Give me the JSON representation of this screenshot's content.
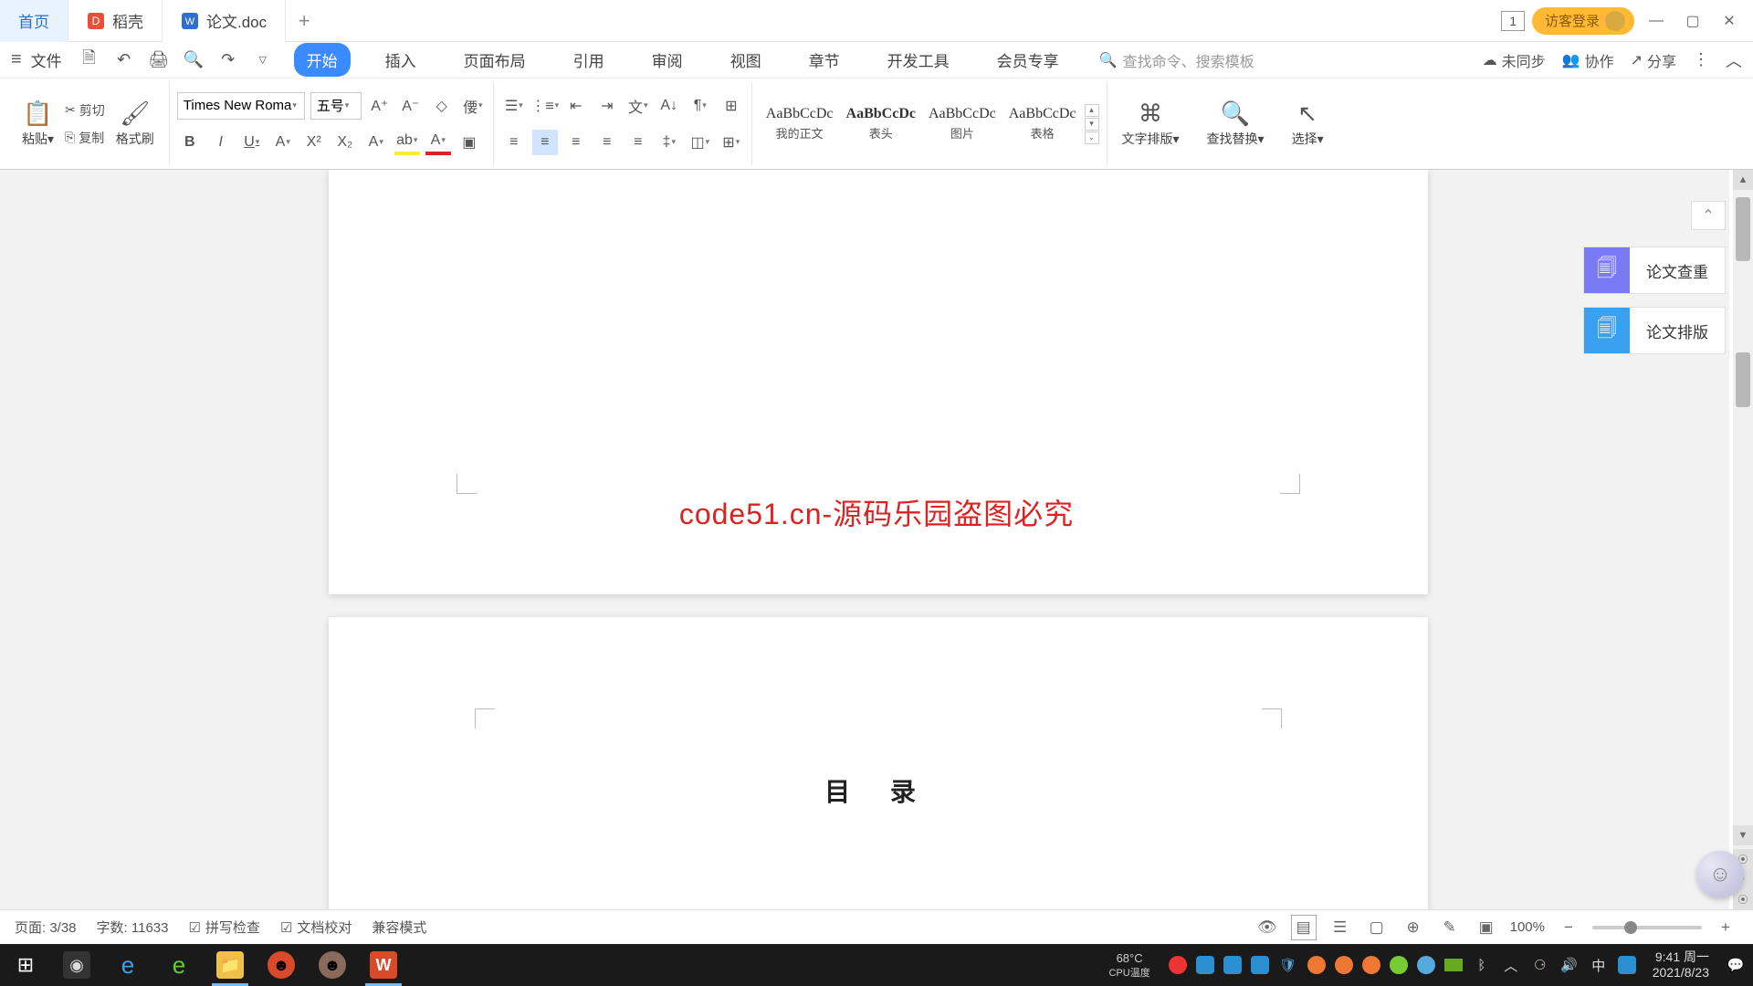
{
  "tabs": {
    "home": "首页",
    "daoke": "稻壳",
    "doc": "论文.doc"
  },
  "titleRight": {
    "badge": "1",
    "guest": "访客登录"
  },
  "menu": {
    "file": "文件",
    "items": [
      "开始",
      "插入",
      "页面布局",
      "引用",
      "审阅",
      "视图",
      "章节",
      "开发工具",
      "会员专享"
    ],
    "searchPlaceholder": "查找命令、搜索模板",
    "unsync": "未同步",
    "collab": "协作",
    "share": "分享"
  },
  "ribbon": {
    "paste": "粘贴",
    "cut": "剪切",
    "copy": "复制",
    "formatPainter": "格式刷",
    "fontName": "Times New Roma",
    "fontSize": "五号",
    "styles": [
      {
        "preview": "AaBbCcDc",
        "name": "我的正文"
      },
      {
        "preview": "AaBbCcDc",
        "name": "表头"
      },
      {
        "preview": "AaBbCcDc",
        "name": "图片"
      },
      {
        "preview": "AaBbCcDc",
        "name": "表格"
      }
    ],
    "textLayout": "文字排版",
    "findReplace": "查找替换",
    "select": "选择"
  },
  "sidePanel": {
    "check": "论文查重",
    "layout": "论文排版"
  },
  "document": {
    "watermark": "code51.cn",
    "centerNotice": "code51.cn-源码乐园盗图必究",
    "tocTitle": "目 录"
  },
  "status": {
    "page": "页面: 3/38",
    "words": "字数: 11633",
    "spell": "拼写检查",
    "docCheck": "文档校对",
    "compat": "兼容模式",
    "zoom": "100%"
  },
  "taskbar": {
    "temp": "68°C",
    "tempLabel": "CPU温度",
    "time": "9:41",
    "day": "周一",
    "date": "2021/8/23",
    "ime": "中"
  }
}
